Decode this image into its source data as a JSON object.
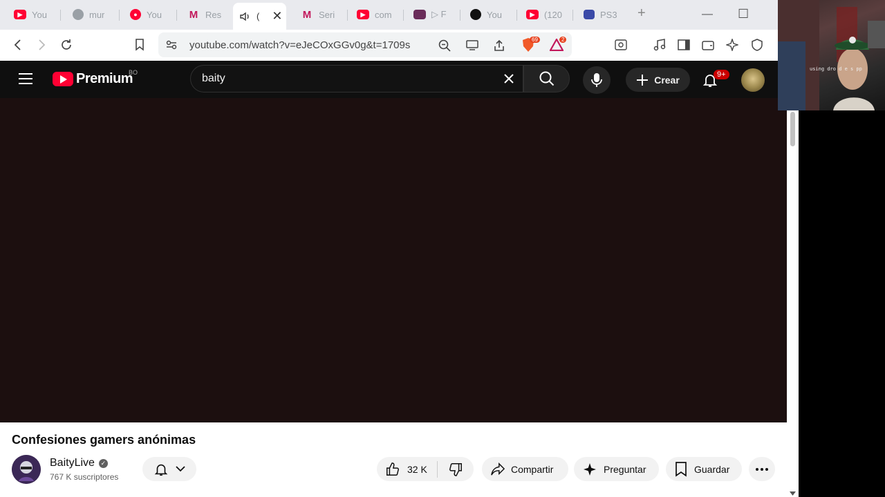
{
  "browser": {
    "tabs": [
      {
        "icon": "youtube-icon",
        "title": "You"
      },
      {
        "icon": "globe-icon",
        "title": "mur"
      },
      {
        "icon": "youtube-music-icon",
        "title": "You"
      },
      {
        "icon": "m-icon",
        "title": "Res"
      },
      {
        "icon": "speaker-icon",
        "title": "(",
        "active": true
      },
      {
        "icon": "m-icon",
        "title": "Seri"
      },
      {
        "icon": "youtube-icon",
        "title": "com"
      },
      {
        "icon": "image-icon",
        "title": "▷ F"
      },
      {
        "icon": "switch-icon",
        "title": "You"
      },
      {
        "icon": "youtube-icon",
        "title": "(120"
      },
      {
        "icon": "ps3-icon",
        "title": "PS3"
      }
    ],
    "url": "youtube.com/watch?v=eJeCOxGGv0g&t=1709s",
    "shields_count": "69",
    "rewards_count": "2"
  },
  "youtube": {
    "logo_text": "Premium",
    "country_code": "BO",
    "search_value": "baity",
    "create_label": "Crear",
    "notifications": "9+"
  },
  "video": {
    "title": "Confesiones gamers anónimas",
    "channel_name": "BaityLive",
    "subscribers": "767 K suscriptores",
    "likes": "32 K",
    "share_label": "Compartir",
    "ask_label": "Preguntar",
    "save_label": "Guardar"
  },
  "overlay": {
    "webcam_text": "using dro d  e  s  pp"
  }
}
